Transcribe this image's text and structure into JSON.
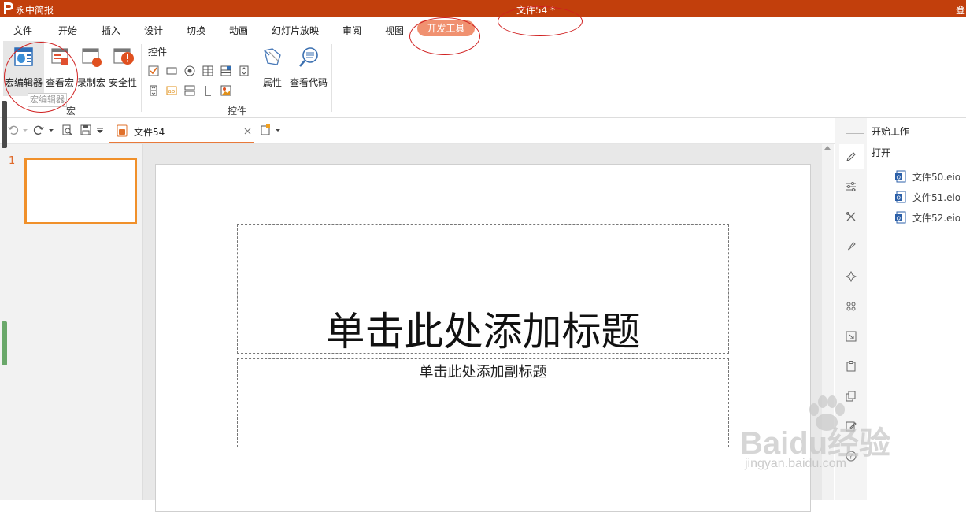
{
  "titlebar": {
    "app_name": "永中简报",
    "doc_title": "文件54 *",
    "login": "登",
    "color": "#c23f0c"
  },
  "menu": {
    "tabs": [
      "文件",
      "开始",
      "插入",
      "设计",
      "切换",
      "动画",
      "幻灯片放映",
      "审阅",
      "视图"
    ],
    "active_tab": "开发工具",
    "active_color": "#f09170"
  },
  "ribbon": {
    "macro_group": {
      "label": "宏",
      "buttons": [
        "宏编辑器",
        "查看宏",
        "录制宏",
        "安全性"
      ],
      "tooltip": "宏编辑器"
    },
    "controls_group": {
      "label": "控件",
      "header": "控件"
    },
    "props_buttons": [
      "属性",
      "查看代码"
    ]
  },
  "toolbar": {
    "doc_tab_label": "文件54"
  },
  "thumbnails": {
    "slide_number": "1"
  },
  "slide": {
    "title_placeholder": "单击此处添加标题",
    "subtitle_placeholder": "单击此处添加副标题"
  },
  "right_panel": {
    "title": "开始工作",
    "open_label": "打开",
    "recent_files": [
      "文件50.eio",
      "文件51.eio",
      "文件52.eio"
    ]
  },
  "watermark": {
    "brand": "Baidu经验",
    "url": "jingyan.baidu.com"
  }
}
